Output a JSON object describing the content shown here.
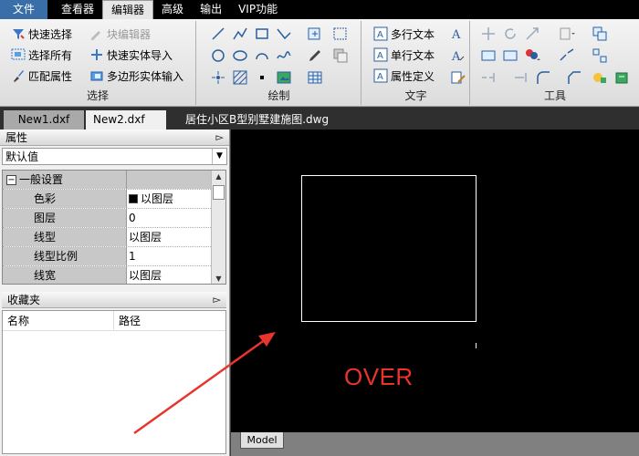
{
  "menubar": {
    "items": [
      "文件",
      "查看器",
      "编辑器",
      "高级",
      "输出",
      "VIP功能"
    ],
    "active": "编辑器"
  },
  "ribbon": {
    "select_group": {
      "title": "选择",
      "quick_select": "快速选择",
      "select_all": "选择所有",
      "match_props": "匹配属性",
      "block_editor": "块编辑器",
      "quick_entity_import": "快速实体导入",
      "polygon_entity_input": "多边形实体输入"
    },
    "draw_group": {
      "title": "绘制"
    },
    "text_group": {
      "title": "文字",
      "mtext": "多行文本",
      "stext": "单行文本",
      "attdef": "属性定义"
    },
    "tools_group": {
      "title": "工具"
    }
  },
  "tabs": {
    "tab1": "New1.dxf",
    "tab2": "New2.dxf",
    "tab3": "居住小区B型别墅建施图.dwg",
    "close_glyph": "✕"
  },
  "properties": {
    "title": "属性",
    "pin": "ᴾ",
    "dropdown_value": "默认值",
    "category": "一般设置",
    "expander": "−",
    "rows": [
      {
        "name": "色彩",
        "value": "以图层"
      },
      {
        "name": "图层",
        "value": "0"
      },
      {
        "name": "线型",
        "value": "以图层"
      },
      {
        "name": "线型比例",
        "value": "1"
      },
      {
        "name": "线宽",
        "value": "以图层"
      }
    ]
  },
  "favorites": {
    "title": "收藏夹",
    "col_name": "名称",
    "col_path": "路径"
  },
  "canvas": {
    "model_tab": "Model",
    "overlay_text": "OVER"
  },
  "colors": {
    "annotation": "#e8342c",
    "menubar": "#000000",
    "canvas": "#000000"
  }
}
